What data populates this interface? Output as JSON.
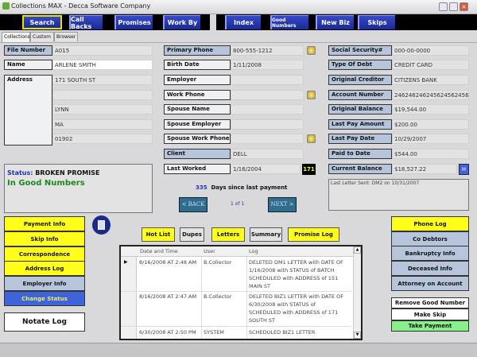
{
  "window": {
    "title": "Collections MAX - Decca Software Company"
  },
  "toolbar": [
    "Search",
    "Call Backs",
    "Promises",
    "Work By",
    "Index",
    "Good Numbers",
    "New Biz",
    "Skips"
  ],
  "tabs": [
    "Collections",
    "Custom",
    "Browser"
  ],
  "left_fields": {
    "file_number_label": "File Number",
    "file_number": "A015",
    "name_label": "Name",
    "name": "ARLENE SMITH",
    "address_label": "Address",
    "address": [
      "171 SOUTH ST",
      "",
      "LYNN",
      "MA",
      "01902"
    ]
  },
  "middle_fields": [
    {
      "label": "Primary Phone",
      "value": "800-555-1212"
    },
    {
      "label": "Birth Date",
      "value": "1/11/2008"
    },
    {
      "label": "Employer",
      "value": ""
    },
    {
      "label": "Work Phone",
      "value": ""
    },
    {
      "label": "Spouse Name",
      "value": ""
    },
    {
      "label": "Spouse Employer",
      "value": ""
    },
    {
      "label": "Spouse Work Phone",
      "value": ""
    },
    {
      "label": "Client",
      "value": "DELL"
    },
    {
      "label": "Last Worked",
      "value": "1/16/2004"
    }
  ],
  "last_worked_badge": "171",
  "right_fields": [
    {
      "label": "Social Security#",
      "value": "000-00-0000"
    },
    {
      "label": "Type Of Debt",
      "value": "CREDIT CARD"
    },
    {
      "label": "Original Creditor",
      "value": "CITIZENS BANK"
    },
    {
      "label": "Account Number",
      "value": "246246246245624562456"
    },
    {
      "label": "Original Balance",
      "value": "$19,544.00"
    },
    {
      "label": "Last Pay Amount",
      "value": "$200.00"
    },
    {
      "label": "Last Pay Date",
      "value": "10/29/2007"
    },
    {
      "label": "Paid to Date",
      "value": "$544.00"
    },
    {
      "label": "Current Balance",
      "value": "$18,527.22"
    }
  ],
  "m_button": "M",
  "last_letter": "Last Letter Sent: DM2 on 10/31/2007",
  "status": {
    "label": "Status:",
    "value": "BROKEN PROMISE",
    "good_numbers": "In Good Numbers"
  },
  "days": {
    "count": "335",
    "text": "Days since last payment"
  },
  "pager": {
    "back": "< BACK",
    "page": "1 of 1",
    "next": "NEXT >"
  },
  "left_buttons": [
    "Payment Info",
    "Skip Info",
    "Correspondence",
    "Address Log",
    "Employer Info",
    "Change Status"
  ],
  "notate_log": "Notate Log",
  "middle_buttons": [
    "Hot List",
    "Dupes",
    "Letters",
    "Summary",
    "Promise Log"
  ],
  "grid": {
    "columns": [
      "Date and Time",
      "User",
      "Log"
    ],
    "rows": [
      {
        "date": "8/16/2008 AT 2:48 AM",
        "user": "B.Collector",
        "log": "DELETED DM1 LETTER with DATE OF 1/16/2008 with STATUS of BATCH SCHEDULED with ADDRESS of 151 MAIN ST"
      },
      {
        "date": "8/16/2008 AT 2:47 AM",
        "user": "B.Collector",
        "log": "DELETED BIZ1 LETTER with DATE OF 6/30/2008 with STATUS of SCHEDULED with ADDRESS of 171 SOUTH ST"
      },
      {
        "date": "6/30/2008 AT 2:50 PM",
        "user": "SYSTEM",
        "log": "SCHEDULED BIZ1 LETTER"
      }
    ]
  },
  "right_buttons": [
    "Phone Log",
    "Co Debtors",
    "Bankruptcy Info",
    "Deceased Info",
    "Attorney on Account"
  ],
  "action_buttons": [
    "Remove Good Number",
    "Make Skip",
    "Take Payment"
  ],
  "colors": {
    "yellow": "#ffff1a",
    "nav_blue": "#1b2a96",
    "green": "#88f08a",
    "status_blue": "#3f63d8"
  }
}
